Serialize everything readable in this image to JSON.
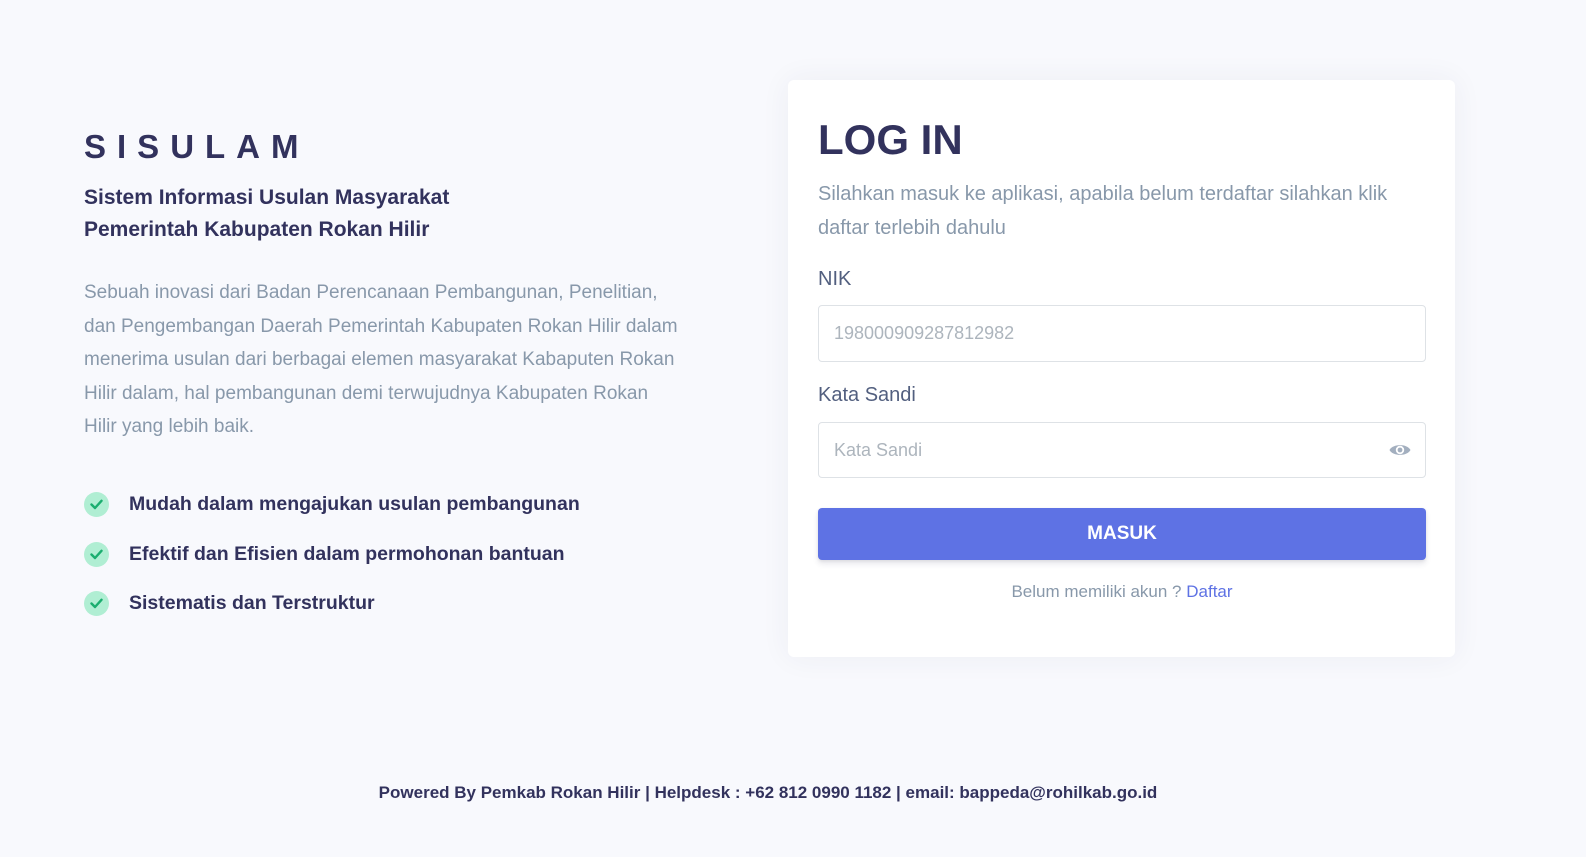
{
  "left": {
    "brand": "SISULAM",
    "subtitle_line1": "Sistem Informasi Usulan Masyarakat",
    "subtitle_line2": "Pemerintah Kabupaten Rokan Hilir",
    "description": "Sebuah inovasi dari Badan Perencanaan Pembangunan, Penelitian, dan Pengembangan Daerah Pemerintah Kabupaten Rokan Hilir dalam menerima usulan dari berbagai elemen masyarakat Kabaputen Rokan Hilir dalam, hal pembangunan demi terwujudnya Kabupaten Rokan Hilir yang lebih baik.",
    "features": [
      {
        "label": "Mudah dalam mengajukan usulan pembangunan",
        "icon": "check-circle-icon"
      },
      {
        "label": "Efektif dan Efisien dalam permohonan bantuan",
        "icon": "check-circle-icon"
      },
      {
        "label": "Sistematis dan Terstruktur",
        "icon": "check-circle-icon"
      }
    ]
  },
  "login": {
    "title": "LOG IN",
    "description": "Silahkan masuk ke aplikasi, apabila belum terdaftar silahkan klik daftar terlebih dahulu",
    "nik_label": "NIK",
    "nik_placeholder": "198000909287812982",
    "nik_value": "",
    "password_label": "Kata Sandi",
    "password_placeholder": "Kata Sandi",
    "password_value": "",
    "password_toggle_icon": "eye-icon",
    "submit_label": "MASUK",
    "signup_text": "Belum memiliki akun ?",
    "signup_link": "Daftar"
  },
  "footer": {
    "text": "Powered By Pemkab Rokan Hilir | Helpdesk : +62 812 0990 1182 | email: bappeda@rohilkab.go.id"
  },
  "colors": {
    "background": "#f8f9fd",
    "primary": "#5e72e4",
    "heading": "#32325d",
    "muted": "#8898aa",
    "check_bg": "#b0eed3",
    "check_fg": "#1aae6f"
  }
}
